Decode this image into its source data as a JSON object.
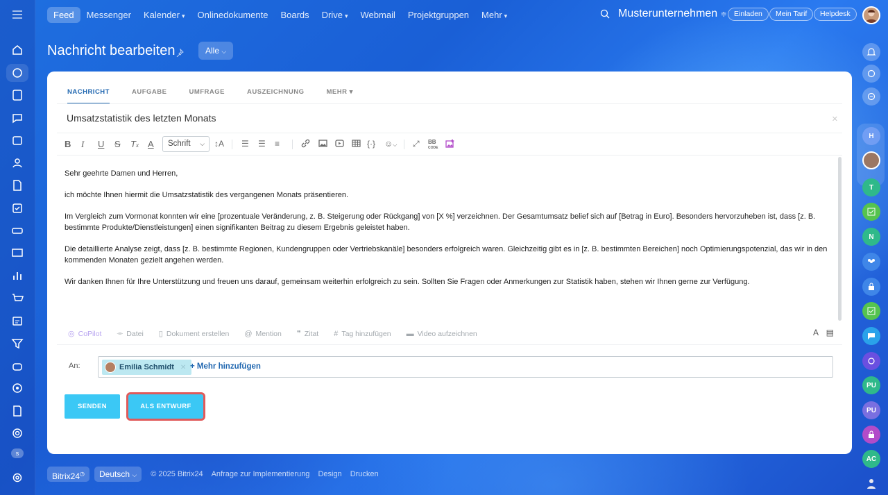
{
  "topnav": {
    "items": [
      {
        "label": "Feed",
        "active": true,
        "caret": false
      },
      {
        "label": "Messenger",
        "caret": false
      },
      {
        "label": "Kalender",
        "caret": true
      },
      {
        "label": "Onlinedokumente",
        "caret": false
      },
      {
        "label": "Boards",
        "caret": false
      },
      {
        "label": "Drive",
        "caret": true
      },
      {
        "label": "Webmail",
        "caret": false
      },
      {
        "label": "Projektgruppen",
        "caret": false
      },
      {
        "label": "Mehr",
        "caret": true
      }
    ],
    "company": "Musterunternehmen",
    "invite": "Einladen",
    "plan": "Mein Tarif",
    "helpdesk": "Helpdesk"
  },
  "page": {
    "title": "Nachricht bearbeiten",
    "filter": "Alle"
  },
  "tabs": [
    {
      "label": "NACHRICHT",
      "active": true
    },
    {
      "label": "AUFGABE"
    },
    {
      "label": "UMFRAGE"
    },
    {
      "label": "AUSZEICHNUNG"
    },
    {
      "label": "MEHR ▾"
    }
  ],
  "subject": "Umsatzstatistik des letzten Monats",
  "toolbar": {
    "font_select": "Schrift"
  },
  "body": [
    "Sehr geehrte Damen und Herren,",
    "ich möchte Ihnen hiermit die Umsatzstatistik des vergangenen Monats präsentieren.",
    "Im Vergleich zum Vormonat konnten wir eine [prozentuale Veränderung, z. B. Steigerung oder Rückgang] von [X %] verzeichnen. Der Gesamtumsatz belief sich auf [Betrag in Euro]. Besonders hervorzuheben ist, dass [z. B. bestimmte Produkte/Dienstleistungen] einen signifikanten Beitrag zu diesem Ergebnis geleistet haben.",
    "Die detaillierte Analyse zeigt, dass [z. B. bestimmte Regionen, Kundengruppen oder Vertriebskanäle] besonders erfolgreich waren. Gleichzeitig gibt es in [z. B. bestimmten Bereichen] noch Optimierungspotenzial, das wir in den kommenden Monaten gezielt angehen werden.",
    "Wir danken Ihnen für Ihre Unterstützung und freuen uns darauf, gemeinsam weiterhin erfolgreich zu sein. Sollten Sie Fragen oder Anmerkungen zur Statistik haben, stehen wir Ihnen gerne zur Verfügung."
  ],
  "attachments": [
    {
      "label": "CoPilot",
      "icon": "copilot-icon"
    },
    {
      "label": "Datei",
      "icon": "paperclip-icon"
    },
    {
      "label": "Dokument erstellen",
      "icon": "document-icon"
    },
    {
      "label": "Mention",
      "icon": "at-icon"
    },
    {
      "label": "Zitat",
      "icon": "quote-icon"
    },
    {
      "label": "Tag hinzufügen",
      "icon": "hash-icon"
    },
    {
      "label": "Video aufzeichnen",
      "icon": "video-icon"
    }
  ],
  "recipients": {
    "label": "An:",
    "selected": "Emilia Schmidt",
    "add_more": "+ Mehr hinzufügen"
  },
  "buttons": {
    "send": "SENDEN",
    "draft": "ALS ENTWURF"
  },
  "footer": {
    "brand": "Bitrix24",
    "language": "Deutsch",
    "copyright": "© 2025 Bitrix24",
    "links": [
      "Anfrage zur Implementierung",
      "Design",
      "Drucken"
    ]
  },
  "right_bar": {
    "avatars": [
      "H",
      "T",
      "N",
      "PU",
      "PU",
      "AC"
    ]
  },
  "left_bar": {
    "badge": "s"
  },
  "colors": {
    "accent": "#3bc8f5",
    "link": "#2067b0",
    "highlight_outline": "#e05a5a"
  }
}
